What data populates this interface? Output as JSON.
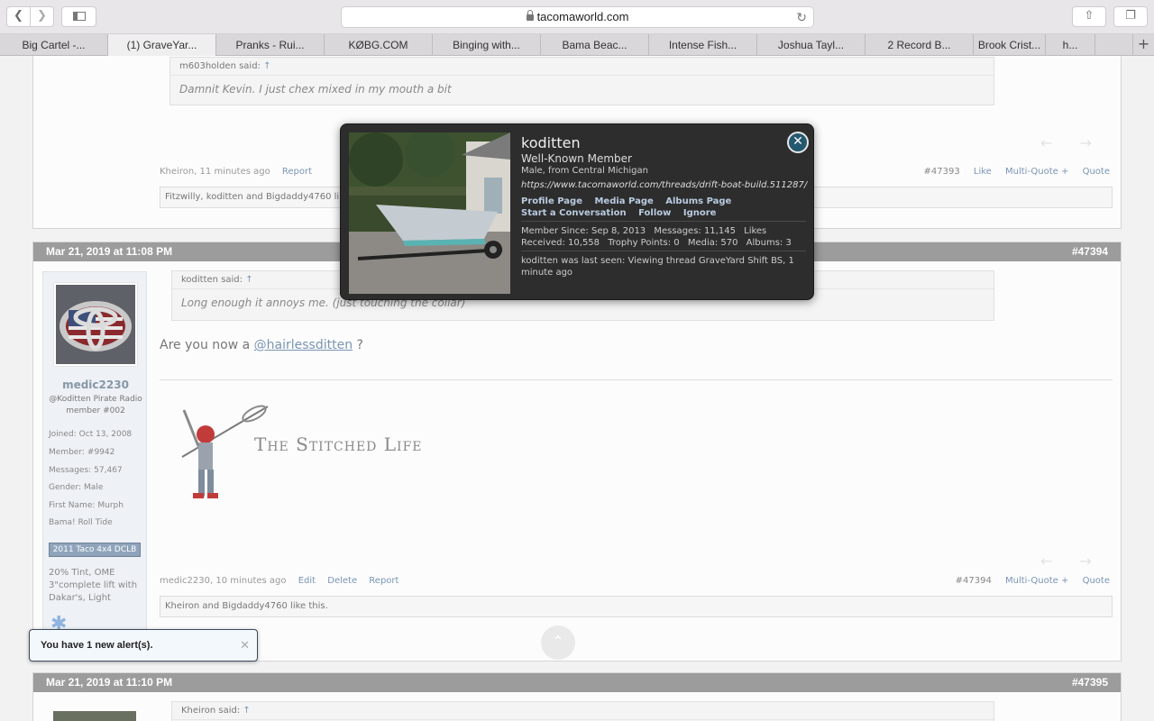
{
  "browser": {
    "url": "tacomaworld.com",
    "tabs": [
      "Big Cartel -...",
      "(1) GraveYar...",
      "Pranks - Rui...",
      "KØBG.COM",
      "Binging with...",
      "Bama Beac...",
      "Intense Fish...",
      "Joshua Tayl...",
      "2 Record B...",
      "Brook Crist...",
      "h..."
    ]
  },
  "post1": {
    "quote_author": "m603holden said:",
    "quote_text": "Damnit Kevin. I just chex mixed in my mouth a bit",
    "author": "Kheiron,",
    "time": "11 minutes ago",
    "report": "Report",
    "number": "#47393",
    "like": "Like",
    "multiquote": "Multi-Quote +",
    "quote": "Quote",
    "likes_text": "Fitzwilly, koditten and Bigdaddy4760 like this."
  },
  "post2": {
    "date": "Mar 21, 2019 at 11:08 PM",
    "number": "#47394",
    "quote_author": "koditten said:",
    "quote_text": "Long enough it annoys me. (just touching the collar)",
    "text_before": "Are you now a",
    "mention": "@hairlessditten",
    "text_after": "?",
    "signature_text": "The Stitched Life",
    "author": "medic2230,",
    "time": "10 minutes ago",
    "edit": "Edit",
    "delete": "Delete",
    "report": "Report",
    "multiquote": "Multi-Quote +",
    "quote": "Quote",
    "likes_text": "Kheiron and Bigdaddy4760 like this.",
    "user": {
      "name": "medic2230",
      "title_line1": "@Koditten Pirate Radio",
      "title_line2": "member #002",
      "joined_label": "Joined:",
      "joined": "Oct 13, 2008",
      "member_label": "Member:",
      "member": "#9942",
      "messages_label": "Messages:",
      "messages": "57,467",
      "gender_label": "Gender:",
      "gender": "Male",
      "firstname_label": "First Name:",
      "firstname": "Murph",
      "extra": "Bama! Roll Tide",
      "badge": "2011 Taco 4x4 DCLB",
      "note": "20% Tint, OME 3\"complete lift with Dakar's, Light"
    }
  },
  "post3": {
    "date": "Mar 21, 2019 at 11:10 PM",
    "number": "#47395",
    "quote_author": "Kheiron said:"
  },
  "popup": {
    "name": "koditten",
    "rank": "Well-Known Member",
    "location": "Male, from Central Michigan",
    "signature": "https://www.tacomaworld.com/threads/drift-boat-build.511287/",
    "links": [
      "Profile Page",
      "Media Page",
      "Albums Page",
      "Start a Conversation",
      "Follow",
      "Ignore"
    ],
    "stats": [
      "Member Since: Sep 8, 2013",
      "Messages: 11,145",
      "Likes Received: 10,558",
      "Trophy Points: 0",
      "Media: 570",
      "Albums: 3"
    ],
    "last_seen": "koditten was last seen: Viewing thread GraveYard Shift BS, 1 minute ago"
  },
  "alert": {
    "text": "You have 1 new alert(s)."
  },
  "colors": {
    "post_header": "#9c9c9c",
    "link": "#7a95b5",
    "popup_bg": "#2d2d2d",
    "close_button": "#24586e"
  }
}
